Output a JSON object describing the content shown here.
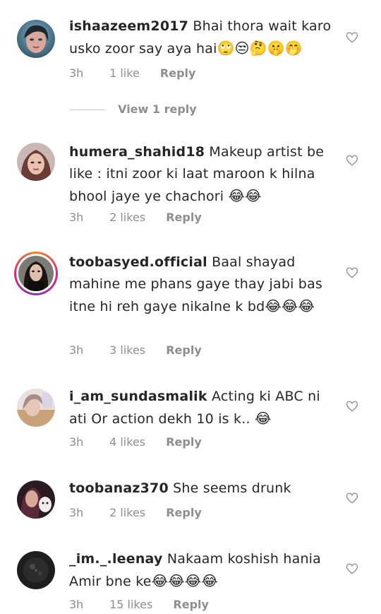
{
  "comments": [
    {
      "username": "ishaazeem2017",
      "text": "Bhai thora wait karo usko zoor say  aya hai",
      "emojis": "🙄😒🤔🤫🤭",
      "time": "3h",
      "likes": "1 like",
      "reply": "Reply",
      "view_replies": "View 1 reply"
    },
    {
      "username": "humera_shahid18",
      "text": "Makeup artist be like : itni zoor ki laat maroon k hilna bhool jaye ye chachori",
      "emojis": "😂😂",
      "time": "3h",
      "likes": "2 likes",
      "reply": "Reply"
    },
    {
      "username": "toobasyed.official",
      "text": "Baal shayad mahine me phans gaye thay jabi bas itne hi reh gaye nikalne k bd",
      "emojis": "😂😂😂",
      "time": "3h",
      "likes": "3 likes",
      "reply": "Reply"
    },
    {
      "username": "i_am_sundasmalik",
      "text": "Acting ki ABC ni ati Or action dekh 10 is k..",
      "emojis": "😂",
      "time": "3h",
      "likes": "4 likes",
      "reply": "Reply"
    },
    {
      "username": "toobanaz370",
      "text": "She seems drunk",
      "emojis": "",
      "time": "3h",
      "likes": "2 likes",
      "reply": "Reply"
    },
    {
      "username": "_im._.leenay",
      "text": "Nakaam koshish hania Amir bne ke",
      "emojis": "😂😂😂😂",
      "time": "3h",
      "likes": "15 likes",
      "reply": "Reply"
    }
  ],
  "icons": {
    "like": "heart-outline-icon"
  },
  "colors": {
    "text": "#262626",
    "secondary": "#8e8e8e",
    "story_ring_start": "#f58529",
    "story_ring_end": "#dd2a7b"
  }
}
